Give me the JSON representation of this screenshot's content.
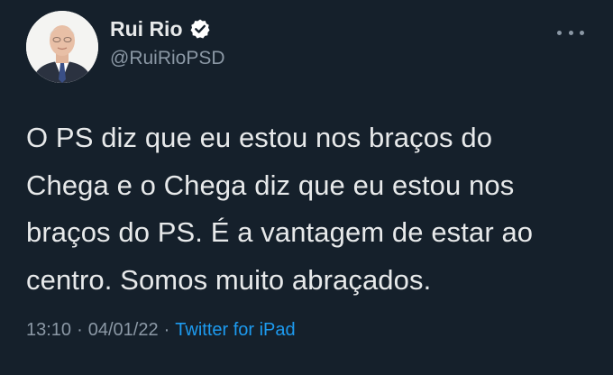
{
  "author": {
    "name": "Rui Rio",
    "handle": "@RuiRioPSD",
    "verified": true,
    "avatar_icon": "profile-photo",
    "verified_icon": "verified-badge-icon"
  },
  "menu": {
    "icon": "more-options-icon"
  },
  "tweet": {
    "text": "O PS diz que eu estou nos braços do\nChega e o Chega diz que eu estou nos\nbraços do PS. É a vantagem de estar ao\ncentro. Somos muito abraçados."
  },
  "meta": {
    "time": "13:10",
    "separator_1": "·",
    "date": "04/01/22",
    "separator_2": "·",
    "source": "Twitter for iPad"
  },
  "colors": {
    "background": "#15202b",
    "primary_text": "#e7e9ea",
    "secondary_text": "#8b98a5",
    "link": "#1d9bf0",
    "badge": "#ffffff"
  }
}
